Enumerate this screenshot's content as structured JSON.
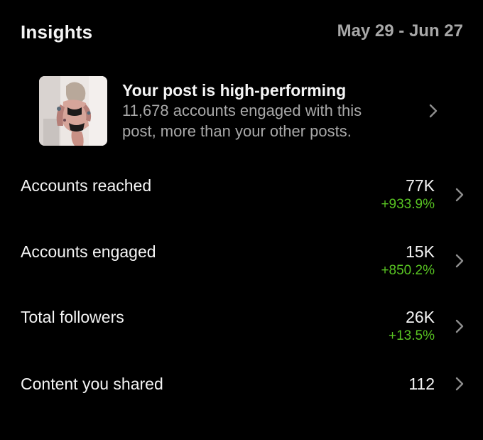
{
  "header": {
    "title": "Insights",
    "date_range": "May 29 - Jun 27"
  },
  "highlight": {
    "title": "Your post is high-performing",
    "description_line1": "11,678 accounts engaged with this",
    "description_line2": "post, more than your other posts."
  },
  "metrics": [
    {
      "label": "Accounts reached",
      "value": "77K",
      "change": "+933.9%"
    },
    {
      "label": "Accounts engaged",
      "value": "15K",
      "change": "+850.2%"
    },
    {
      "label": "Total followers",
      "value": "26K",
      "change": "+13.5%"
    },
    {
      "label": "Content you shared",
      "value": "112"
    }
  ],
  "colors": {
    "background": "#000000",
    "primary_text": "#f5f5f5",
    "secondary_text": "#a8a8a8",
    "positive_change": "#58c322",
    "chevron": "#8e8e8e"
  },
  "icons": {
    "chevron": "chevron-right-icon",
    "post_thumbnail": "post-thumbnail-image"
  }
}
